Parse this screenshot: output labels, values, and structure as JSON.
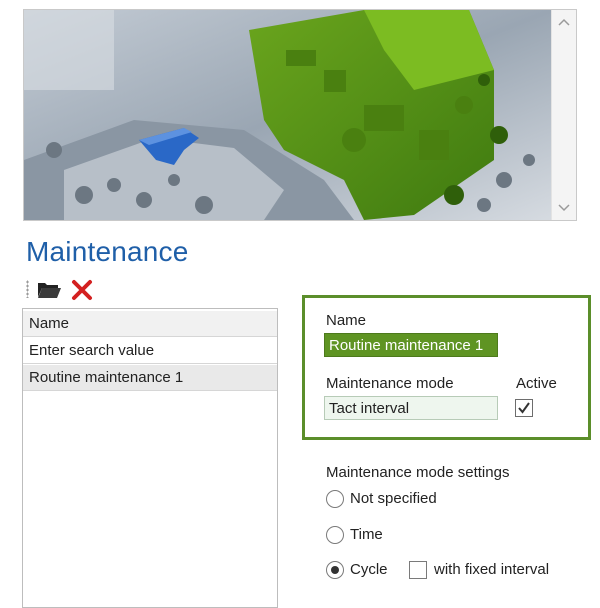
{
  "image": {
    "scroll_up_icon": "chevron-up-icon",
    "scroll_down_icon": "chevron-down-icon"
  },
  "page": {
    "title": "Maintenance"
  },
  "toolbar": {
    "open_icon": "folder-open-icon",
    "delete_icon": "delete-x-icon"
  },
  "list": {
    "header": "Name",
    "search_placeholder": "Enter search value",
    "items": [
      "Routine maintenance 1"
    ]
  },
  "form": {
    "name_label": "Name",
    "name_value": "Routine maintenance 1",
    "mode_label": "Maintenance mode",
    "mode_value": "Tact interval",
    "active_label": "Active",
    "active_checked": true
  },
  "mode_settings": {
    "title": "Maintenance mode settings",
    "options": [
      "Not specified",
      "Time",
      "Cycle"
    ],
    "selected": "Cycle",
    "fixed_interval_label": "with fixed interval",
    "fixed_interval_checked": false
  },
  "colors": {
    "accent": "#1f5fa8",
    "green": "#5b8e2a",
    "highlight": "#5f9423",
    "delete": "#d32020"
  }
}
